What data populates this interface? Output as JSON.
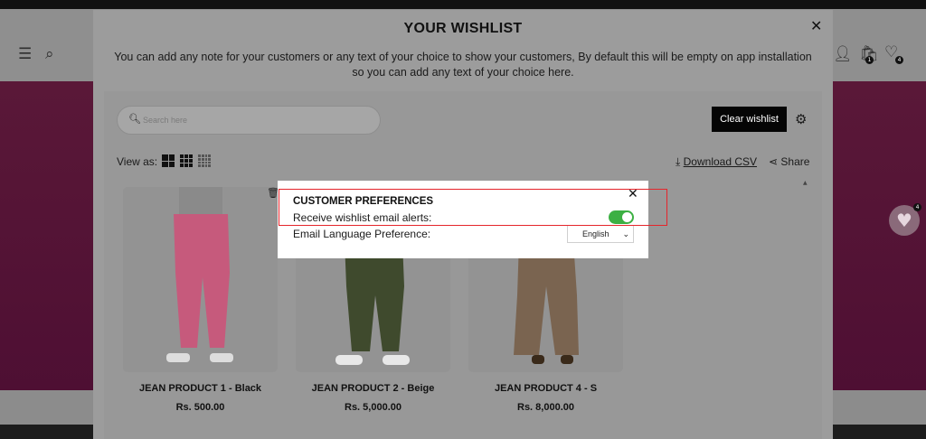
{
  "modal": {
    "title": "YOUR WISHLIST",
    "note": "You can add any note for your customers or any text of your choice to show your customers, By default this will be empty on app installation so you can add any text of your choice here."
  },
  "search": {
    "placeholder": "Search here"
  },
  "toolbar": {
    "clear_label": "Clear wishlist",
    "view_as_label": "View as:",
    "download_label": "Download CSV",
    "share_label": "Share"
  },
  "header_badges": {
    "cart_count": "1",
    "wishlist_count": "4"
  },
  "floating_badge": "4",
  "products": [
    {
      "title": "JEAN PRODUCT 1 - Black",
      "price": "Rs. 500.00",
      "color": "#c65a7c"
    },
    {
      "title": "JEAN PRODUCT 2 - Beige",
      "price": "Rs. 5,000.00",
      "color": "#3f4a2d"
    },
    {
      "title": "JEAN PRODUCT 4 - S",
      "price": "Rs. 8,000.00",
      "color": "#7a6450"
    }
  ],
  "preferences": {
    "title": "CUSTOMER PREFERENCES",
    "email_alerts_label": "Receive wishlist email alerts:",
    "email_alerts_enabled": true,
    "language_label": "Email Language Preference:",
    "language_value": "English"
  },
  "colors": {
    "accent_green": "#3cb043",
    "highlight_red": "#e5252b",
    "banner": "#5a1838"
  }
}
